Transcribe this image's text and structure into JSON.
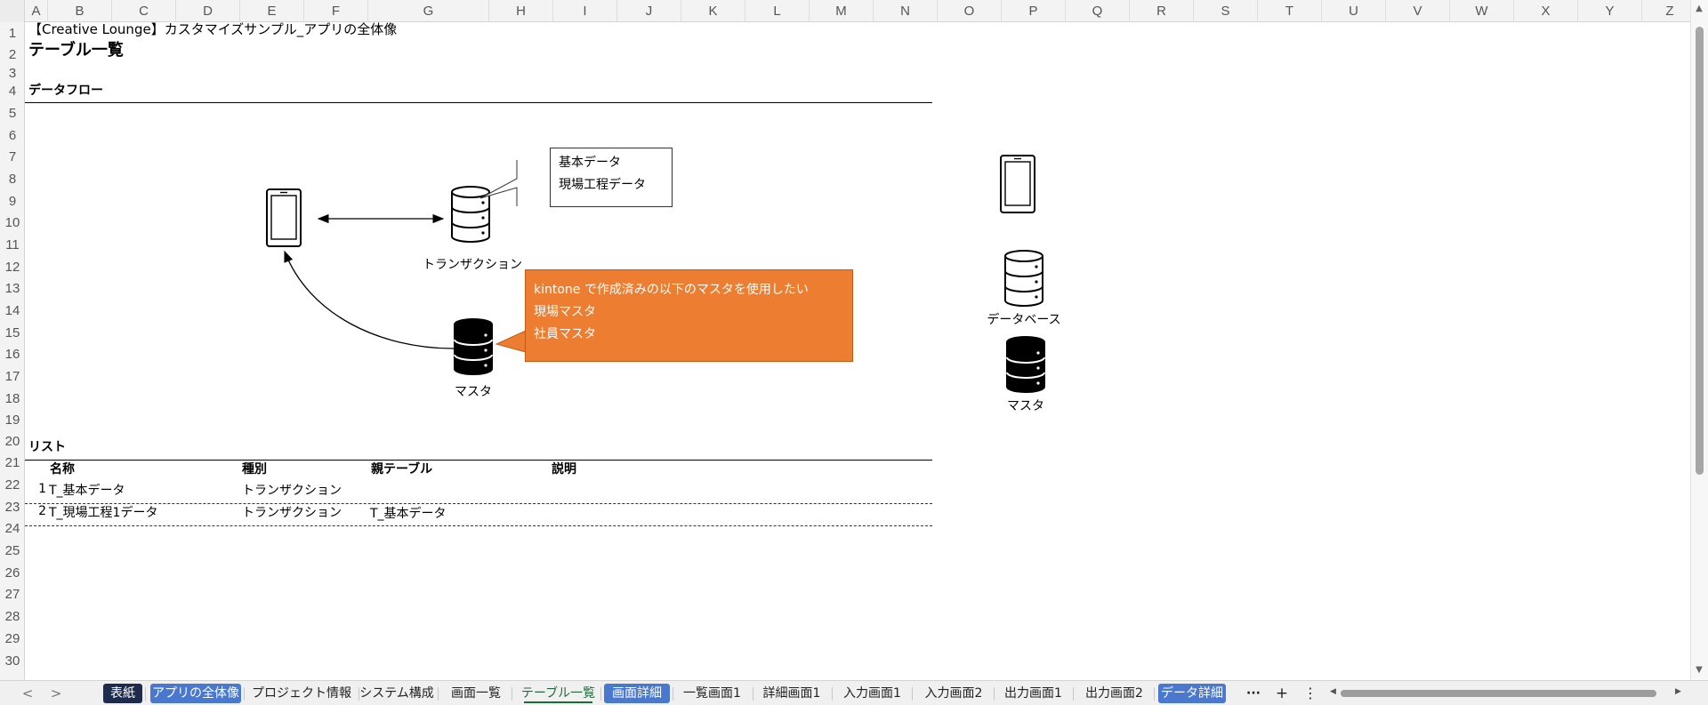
{
  "columns": [
    "A",
    "B",
    "C",
    "D",
    "E",
    "F",
    "G",
    "H",
    "I",
    "J",
    "K",
    "L",
    "M",
    "N",
    "O",
    "P",
    "Q",
    "R",
    "S",
    "T",
    "U",
    "V",
    "W",
    "X",
    "Y",
    "Z"
  ],
  "rows": [
    "1",
    "2",
    "3",
    "4",
    "5",
    "6",
    "7",
    "8",
    "9",
    "10",
    "11",
    "12",
    "13",
    "14",
    "15",
    "16",
    "17",
    "18",
    "19",
    "20",
    "21",
    "22",
    "23",
    "24",
    "25",
    "26",
    "27",
    "28",
    "29",
    "30"
  ],
  "sheet": {
    "title_line": "【Creative Lounge】カスタマイズサンプル_アプリの全体像",
    "heading": "テーブル一覧",
    "section_dataflow": "データフロー",
    "section_list": "リスト",
    "list_headers": {
      "name": "名称",
      "type": "種別",
      "parent": "親テーブル",
      "desc": "説明"
    },
    "list_rows": [
      {
        "num": "1",
        "name": "T_基本データ",
        "type": "トランザクション",
        "parent": "",
        "desc": ""
      },
      {
        "num": "2",
        "name": "T_現場工程1データ",
        "type": "トランザクション",
        "parent": "T_基本データ",
        "desc": ""
      }
    ]
  },
  "diagram": {
    "transaction_label": "トランザクション",
    "master_label": "マスタ",
    "callout_transaction": {
      "line1": "基本データ",
      "line2": "現場工程データ"
    },
    "callout_master": {
      "line1": "kintone で作成済みの以下のマスタを使用したい",
      "line2": "現場マスタ",
      "line3": "社員マスタ"
    }
  },
  "legend": {
    "database_label": "データベース",
    "master_label": "マスタ"
  },
  "tabs": [
    {
      "label": "表紙",
      "style": "dark"
    },
    {
      "label": "アプリの全体像",
      "style": "blue"
    },
    {
      "label": "プロジェクト情報",
      "style": "plain"
    },
    {
      "label": "システム構成",
      "style": "plain"
    },
    {
      "label": "画面一覧",
      "style": "plain"
    },
    {
      "label": "テーブル一覧",
      "style": "active"
    },
    {
      "label": "画面詳細",
      "style": "blue"
    },
    {
      "label": "一覧画面1",
      "style": "plain"
    },
    {
      "label": "詳細画面1",
      "style": "plain"
    },
    {
      "label": "入力画面1",
      "style": "plain"
    },
    {
      "label": "入力画面2",
      "style": "plain"
    },
    {
      "label": "出力画面1",
      "style": "plain"
    },
    {
      "label": "出力画面2",
      "style": "plain"
    },
    {
      "label": "データ詳細",
      "style": "blue"
    }
  ],
  "tabbar": {
    "prev": "<",
    "next": ">",
    "more": "···",
    "add": "+",
    "menu": "⋮"
  },
  "colors": {
    "accent_orange": "#ed7d31",
    "tab_dark": "#1f2b4d",
    "tab_blue": "#4a78cf",
    "active_tab_green": "#1d6b3a"
  }
}
